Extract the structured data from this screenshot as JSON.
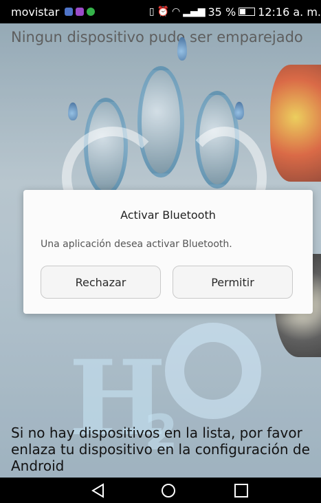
{
  "status_bar": {
    "carrier": "movistar",
    "notif_icons": [
      "chat-bubble-icon",
      "gallery-icon",
      "whatsapp-icon"
    ],
    "right_icons": [
      "vibrate-icon",
      "alarm-icon",
      "wifi-icon",
      "signal-icon"
    ],
    "battery_percent": "35 %",
    "time": "12:16 a. m."
  },
  "app": {
    "header": "Ningun dispositivo pudo ser emparejado",
    "help_lines": [
      "Si no hay dispositivos en la lista, por favor",
      "enlaza tu dispositivo en la configuración de",
      "Android"
    ]
  },
  "dialog": {
    "title": "Activar Bluetooth",
    "message": "Una aplicación desea activar Bluetooth.",
    "reject_label": "Rechazar",
    "allow_label": "Permitir"
  },
  "nav_bar": {
    "buttons": [
      "back-icon",
      "home-icon",
      "recent-apps-icon"
    ]
  },
  "colors": {
    "status_bar_bg": "#000000",
    "dialog_bg": "#fbfbfb",
    "button_bg": "#f5f5f5"
  }
}
